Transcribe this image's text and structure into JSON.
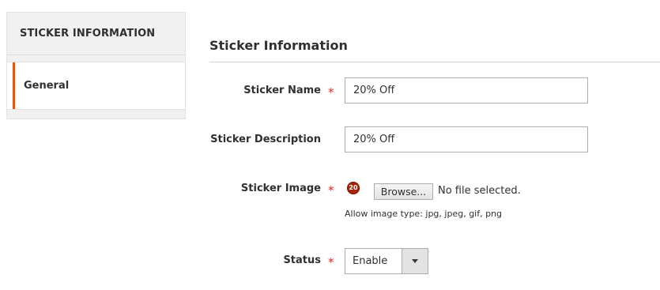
{
  "sidebar": {
    "title": "STICKER INFORMATION",
    "items": [
      {
        "label": "General"
      }
    ]
  },
  "section": {
    "title": "Sticker Information"
  },
  "fields": {
    "sticker_name": {
      "label": "Sticker Name",
      "required_mark": "*",
      "value": "20% Off"
    },
    "sticker_description": {
      "label": "Sticker Description",
      "value": "20% Off"
    },
    "sticker_image": {
      "label": "Sticker Image",
      "required_mark": "*",
      "badge": "20",
      "browse_label": "Browse...",
      "file_status": "No file selected.",
      "note": "Allow image type: jpg, jpeg, gif, png"
    },
    "status": {
      "label": "Status",
      "required_mark": "*",
      "selected": "Enable"
    }
  },
  "colors": {
    "accent": "#eb5202",
    "required": "#e22626",
    "badge": "#a4250a"
  }
}
